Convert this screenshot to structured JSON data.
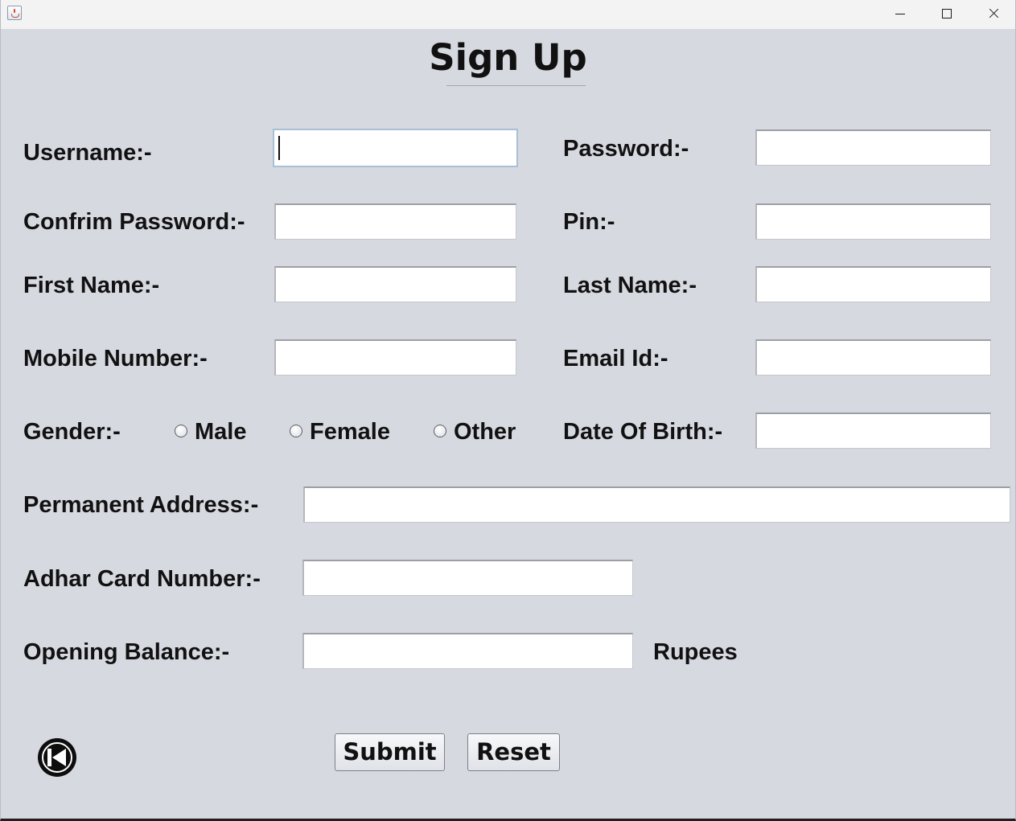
{
  "window": {
    "minimize_icon": "minimize-icon",
    "maximize_icon": "maximize-icon",
    "close_icon": "close-icon",
    "app_icon": "java-cup-icon"
  },
  "form": {
    "title": "Sign Up",
    "labels": {
      "username": "Username:-",
      "password": "Password:-",
      "confirm_password": "Confrim Password:-",
      "pin": "Pin:-",
      "first_name": "First Name:-",
      "last_name": "Last Name:-",
      "mobile_number": "Mobile Number:-",
      "email_id": "Email Id:-",
      "gender": "Gender:-",
      "date_of_birth": "Date Of Birth:-",
      "permanent_address": "Permanent Address:-",
      "adhar_card_number": "Adhar Card Number:-",
      "opening_balance": "Opening Balance:-",
      "rupees": "Rupees"
    },
    "values": {
      "username": "",
      "password": "",
      "confirm_password": "",
      "pin": "",
      "first_name": "",
      "last_name": "",
      "mobile_number": "",
      "email_id": "",
      "date_of_birth": "",
      "permanent_address": "",
      "adhar_card_number": "",
      "opening_balance": ""
    },
    "gender_options": {
      "male": "Male",
      "female": "Female",
      "other": "Other"
    },
    "buttons": {
      "submit": "Submit",
      "reset": "Reset",
      "back_icon": "back-arrow-icon"
    }
  }
}
